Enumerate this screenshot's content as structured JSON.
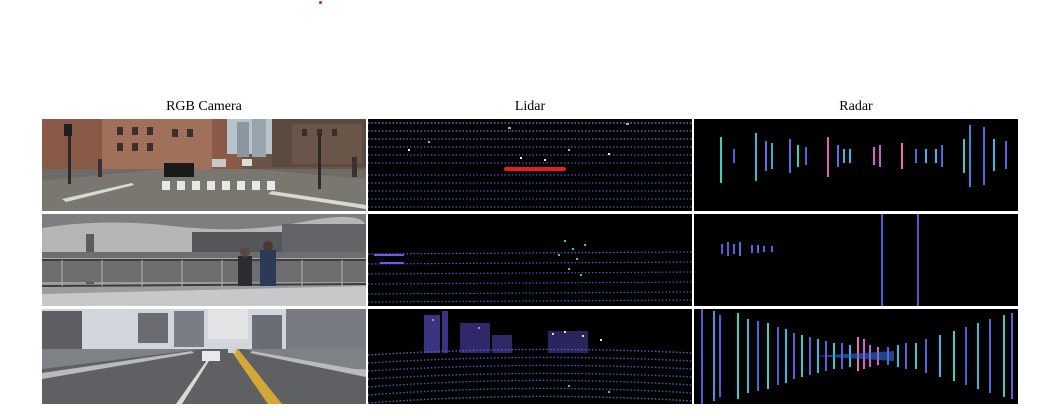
{
  "figure": {
    "columns": [
      {
        "label": "RGB Camera"
      },
      {
        "label": "Lidar"
      },
      {
        "label": "Radar"
      }
    ],
    "rows": 3
  }
}
